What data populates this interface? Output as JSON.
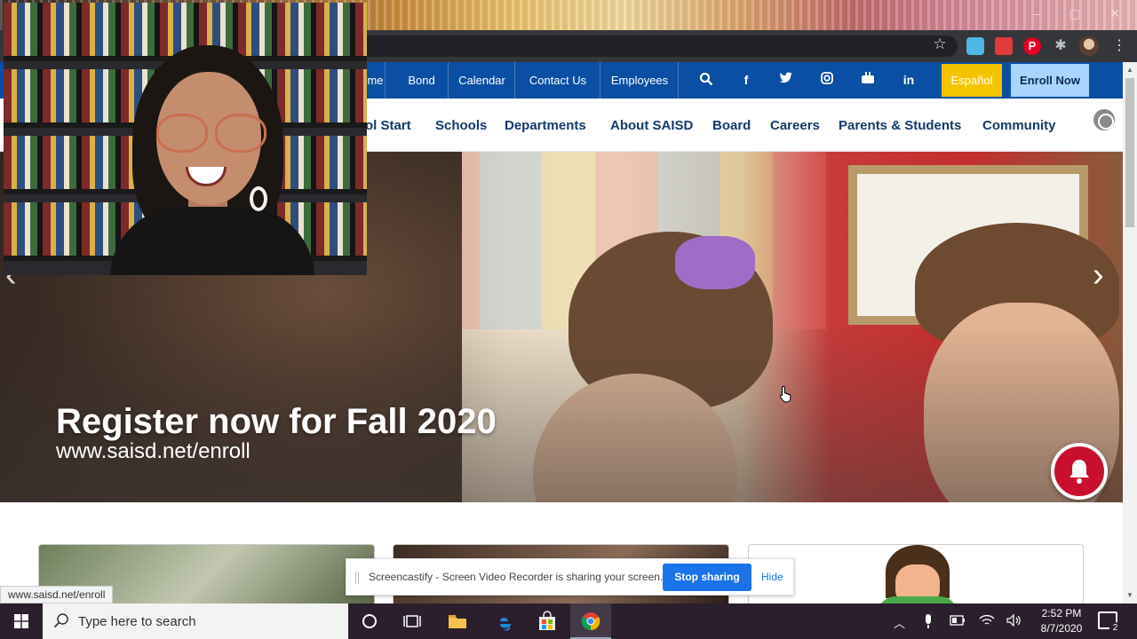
{
  "browser": {
    "window_controls": [
      "–",
      "▢",
      "✕"
    ]
  },
  "topnav": {
    "items": [
      "me",
      "Bond",
      "Calendar",
      "Contact Us",
      "Employees"
    ],
    "social_icons": [
      "search-icon",
      "facebook-icon",
      "twitter-icon",
      "instagram-icon",
      "youtube-icon",
      "linkedin-icon"
    ],
    "espanol_label": "Español",
    "enroll_label": "Enroll Now",
    "colors": {
      "bar": "#0a4fa3",
      "espanol": "#f5c400",
      "enroll": "#a9d4ff"
    }
  },
  "mainnav": {
    "items": [
      "ol Start",
      "Schools",
      "Departments",
      "About SAISD",
      "Board",
      "Careers",
      "Parents & Students",
      "Community"
    ]
  },
  "hero": {
    "title": "Register now for Fall 2020",
    "url": "www.saisd.net/enroll"
  },
  "screencastify": {
    "message": "Screencastify - Screen Video Recorder is sharing your screen.",
    "stop_label": "Stop sharing",
    "hide_label": "Hide"
  },
  "status_url": "www.saisd.net/enroll",
  "taskbar": {
    "search_placeholder": "Type here to search",
    "time": "2:52 PM",
    "date": "8/7/2020",
    "notification_count": "2"
  }
}
